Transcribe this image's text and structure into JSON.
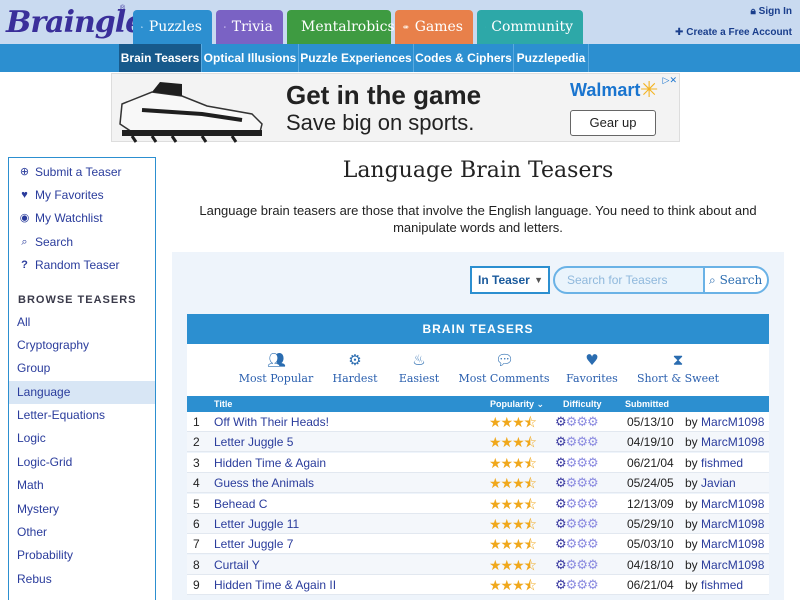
{
  "header": {
    "logo_text": "Braingle",
    "logo_tm": "®",
    "tabs": [
      {
        "label": "Puzzles",
        "icon": "puzzle-icon"
      },
      {
        "label": "Trivia",
        "icon": "book-icon"
      },
      {
        "label": "Mentalrobics",
        "icon": "bulb-icon"
      },
      {
        "label": "Games",
        "icon": "gamepad-icon"
      },
      {
        "label": "Community",
        "icon": "users-icon"
      }
    ],
    "sign_in": "Sign In",
    "create_account": "Create a Free Account"
  },
  "subnav": {
    "items": [
      "Brain Teasers",
      "Optical Illusions",
      "Puzzle Experiences",
      "Codes & Ciphers",
      "Puzzlepedia"
    ]
  },
  "ad": {
    "headline": "Get in the game",
    "subline": "Save big on sports.",
    "brand": "Walmart",
    "button": "Gear up"
  },
  "sidebar": {
    "links": [
      {
        "label": "Submit a Teaser",
        "icon": "plus-circle-icon"
      },
      {
        "label": "My Favorites",
        "icon": "heart-icon"
      },
      {
        "label": "My Watchlist",
        "icon": "eye-icon"
      },
      {
        "label": "Search",
        "icon": "search-icon"
      },
      {
        "label": "Random Teaser",
        "icon": "question-icon"
      }
    ],
    "browse_heading": "BROWSE TEASERS",
    "categories": [
      "All",
      "Cryptography",
      "Group",
      "Language",
      "Letter-Equations",
      "Logic",
      "Logic-Grid",
      "Math",
      "Mystery",
      "Other",
      "Probability",
      "Rebus"
    ],
    "active_category": "Language"
  },
  "main": {
    "title": "Language Brain Teasers",
    "intro": "Language brain teasers are those that involve the English language. You need to think about and manipulate words and letters.",
    "search": {
      "scope": "In Teaser",
      "placeholder": "Search for Teasers",
      "button": "Search"
    },
    "section_title": "BRAIN TEASERS",
    "sorts": [
      {
        "label": "Most Popular",
        "icon": "users-icon"
      },
      {
        "label": "Hardest",
        "icon": "gears-icon"
      },
      {
        "label": "Easiest",
        "icon": "cake-icon"
      },
      {
        "label": "Most Comments",
        "icon": "comments-icon"
      },
      {
        "label": "Favorites",
        "icon": "heart-icon"
      },
      {
        "label": "Short & Sweet",
        "icon": "hourglass-icon"
      }
    ],
    "table": {
      "headers": {
        "title": "Title",
        "popularity": "Popularity ⌄",
        "difficulty": "Difficulty",
        "submitted": "Submitted"
      },
      "rows": [
        {
          "num": "1",
          "title": "Off With Their Heads!",
          "popularity": 3.5,
          "difficulty": 1,
          "date": "05/13/10",
          "by": "by",
          "author": "MarcM1098"
        },
        {
          "num": "2",
          "title": "Letter Juggle 5",
          "popularity": 3.5,
          "difficulty": 1,
          "date": "04/19/10",
          "by": "by",
          "author": "MarcM1098"
        },
        {
          "num": "3",
          "title": "Hidden Time & Again",
          "popularity": 3.5,
          "difficulty": 1,
          "date": "06/21/04",
          "by": "by",
          "author": "fishmed"
        },
        {
          "num": "4",
          "title": "Guess the Animals",
          "popularity": 3.5,
          "difficulty": 1,
          "date": "05/24/05",
          "by": "by",
          "author": "Javian"
        },
        {
          "num": "5",
          "title": "Behead C",
          "popularity": 3.5,
          "difficulty": 1,
          "date": "12/13/09",
          "by": "by",
          "author": "MarcM1098"
        },
        {
          "num": "6",
          "title": "Letter Juggle 11",
          "popularity": 3.5,
          "difficulty": 1,
          "date": "05/29/10",
          "by": "by",
          "author": "MarcM1098"
        },
        {
          "num": "7",
          "title": "Letter Juggle 7",
          "popularity": 3.5,
          "difficulty": 1,
          "date": "05/03/10",
          "by": "by",
          "author": "MarcM1098"
        },
        {
          "num": "8",
          "title": "Curtail Y",
          "popularity": 3.5,
          "difficulty": 1,
          "date": "04/18/10",
          "by": "by",
          "author": "MarcM1098"
        },
        {
          "num": "9",
          "title": "Hidden Time & Again II",
          "popularity": 3.5,
          "difficulty": 1,
          "date": "06/21/04",
          "by": "by",
          "author": "fishmed"
        }
      ]
    }
  },
  "colors": {
    "accent": "#2c8fd0",
    "link": "#2a3c9c",
    "star": "#f0a81c"
  }
}
